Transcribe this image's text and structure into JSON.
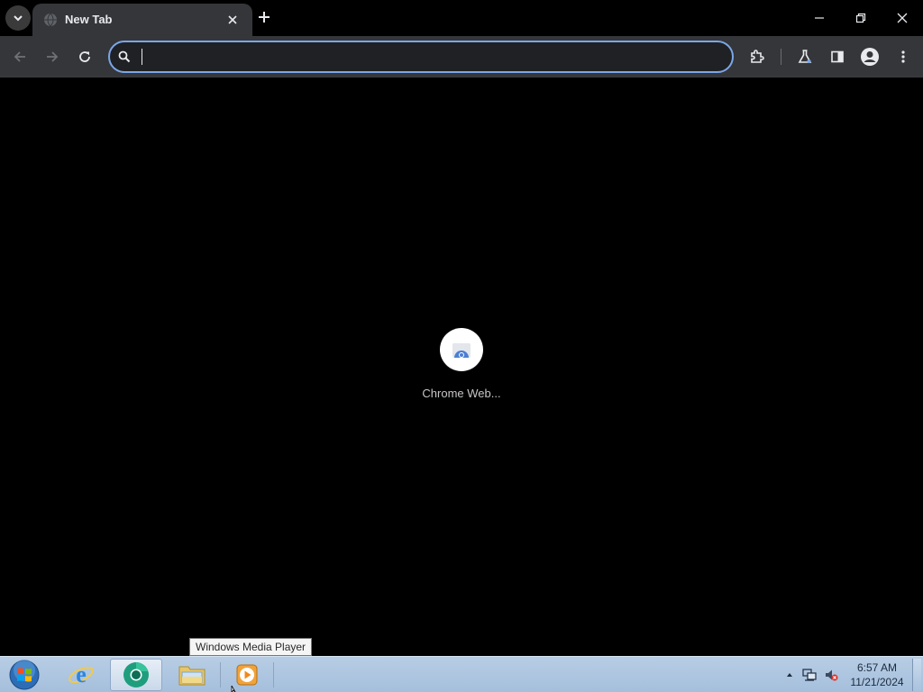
{
  "browser": {
    "tab": {
      "title": "New Tab"
    },
    "toolbar": {
      "address_value": "",
      "address_placeholder": ""
    }
  },
  "content": {
    "shortcuts": [
      {
        "label": "Chrome Web...",
        "icon": "chrome-web-store-icon"
      }
    ]
  },
  "taskbar": {
    "apps": [
      {
        "name": "internet-explorer",
        "icon": "internet-explorer-icon"
      },
      {
        "name": "chrome",
        "icon": "chrome-icon",
        "active": true
      },
      {
        "name": "file-explorer",
        "icon": "folder-icon"
      },
      {
        "name": "windows-media-player",
        "icon": "media-player-icon"
      }
    ],
    "tooltip": "Windows Media Player",
    "clock": {
      "time": "6:57 AM",
      "date": "11/21/2024"
    }
  },
  "colors": {
    "accent": "#7aa7e8",
    "toolbar_bg": "#35363a",
    "content_bg": "#000000",
    "taskbar_bg": "#a5bfdc"
  }
}
